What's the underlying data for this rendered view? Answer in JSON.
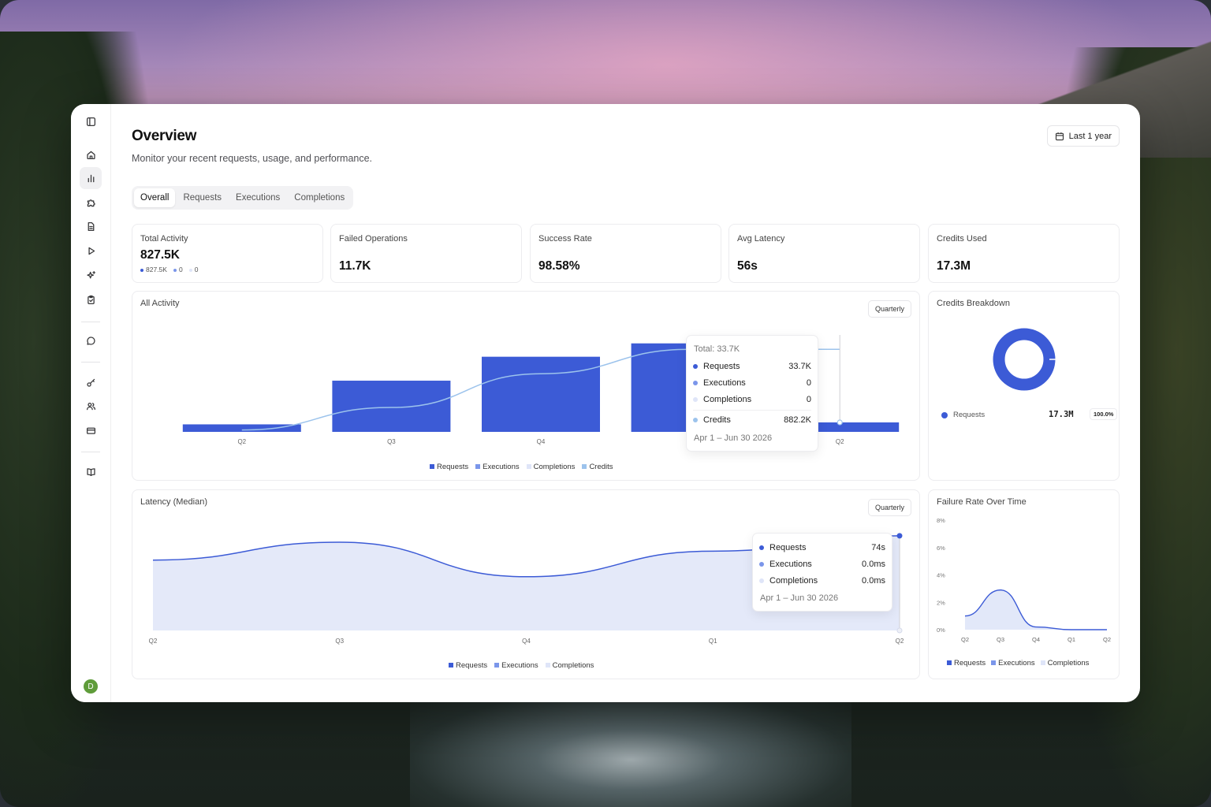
{
  "colors": {
    "requests": "#3c5bd6",
    "executions": "#7b96ea",
    "completions": "#dfe5f8",
    "credits": "#9cc3ec",
    "avatar": "#5f9c3a"
  },
  "sidebar": {
    "items": [
      {
        "name": "sidebar-toggle-icon"
      },
      {
        "name": "home-icon"
      },
      {
        "name": "bar-chart-icon",
        "active": true
      },
      {
        "name": "puzzle-icon"
      },
      {
        "name": "document-icon"
      },
      {
        "name": "play-icon"
      },
      {
        "name": "sparkles-icon"
      },
      {
        "name": "clipboard-check-icon"
      },
      {
        "name": "chat-icon"
      },
      {
        "name": "key-icon"
      },
      {
        "name": "users-icon"
      },
      {
        "name": "credit-card-icon"
      },
      {
        "name": "book-icon"
      }
    ],
    "avatar_initial": "D"
  },
  "header": {
    "title": "Overview",
    "subtitle": "Monitor your recent requests, usage, and performance.",
    "date_range": "Last 1 year"
  },
  "tabs": [
    "Overall",
    "Requests",
    "Executions",
    "Completions"
  ],
  "stats": {
    "total_activity": {
      "label": "Total Activity",
      "value": "827.5K",
      "legend": [
        "827.5K",
        "0",
        "0"
      ]
    },
    "failed_operations": {
      "label": "Failed Operations",
      "value": "11.7K"
    },
    "success_rate": {
      "label": "Success Rate",
      "value": "98.58%"
    },
    "avg_latency": {
      "label": "Avg Latency",
      "value": "56s"
    },
    "credits_used": {
      "label": "Credits Used",
      "value": "17.3M"
    }
  },
  "all_activity": {
    "title": "All Activity",
    "interval": "Quarterly",
    "legend": [
      "Requests",
      "Executions",
      "Completions",
      "Credits"
    ],
    "tooltip": {
      "total": "Total: 33.7K",
      "rows": [
        {
          "label": "Requests",
          "value": "33.7K"
        },
        {
          "label": "Executions",
          "value": "0"
        },
        {
          "label": "Completions",
          "value": "0"
        },
        {
          "label": "Credits",
          "value": "882.2K"
        }
      ],
      "date": "Apr 1 – Jun 30 2026"
    }
  },
  "credits_breakdown": {
    "title": "Credits Breakdown",
    "rows": [
      {
        "label": "Requests",
        "value": "17.3M",
        "pct": "100.0%"
      }
    ]
  },
  "latency": {
    "title": "Latency (Median)",
    "interval": "Quarterly",
    "legend": [
      "Requests",
      "Executions",
      "Completions"
    ],
    "tooltip": {
      "rows": [
        {
          "label": "Requests",
          "value": "74s"
        },
        {
          "label": "Executions",
          "value": "0.0ms"
        },
        {
          "label": "Completions",
          "value": "0.0ms"
        }
      ],
      "date": "Apr 1 – Jun 30 2026"
    }
  },
  "failure_rate": {
    "title": "Failure Rate Over Time",
    "legend": [
      "Requests",
      "Executions",
      "Completions"
    ]
  },
  "chart_data": [
    {
      "type": "bar",
      "title": "All Activity",
      "categories": [
        "Q2",
        "Q3",
        "Q4",
        "Q1",
        "Q2"
      ],
      "series": [
        {
          "name": "Requests",
          "values": [
            2.7,
            18.4,
            27.0,
            31.8,
            3.4
          ]
        },
        {
          "name": "Executions",
          "values": [
            0,
            0,
            0,
            0,
            0
          ]
        },
        {
          "name": "Completions",
          "values": [
            0,
            0,
            0,
            0,
            0
          ]
        }
      ],
      "line_series": {
        "name": "Credits",
        "values": [
          0.02,
          0.26,
          0.62,
          0.88,
          0.88
        ]
      },
      "ylim": [
        0,
        33.7
      ]
    },
    {
      "type": "pie",
      "title": "Credits Breakdown",
      "categories": [
        "Requests"
      ],
      "values": [
        100.0
      ]
    },
    {
      "type": "area",
      "title": "Latency (Median)",
      "categories": [
        "Q2",
        "Q3",
        "Q4",
        "Q1",
        "Q2"
      ],
      "series": [
        {
          "name": "Requests",
          "values": [
            55,
            69,
            42,
            62,
            74
          ]
        },
        {
          "name": "Executions",
          "values": [
            0,
            0,
            0,
            0,
            0
          ]
        },
        {
          "name": "Completions",
          "values": [
            0,
            0,
            0,
            0,
            0
          ]
        }
      ],
      "ylim": [
        0,
        85
      ]
    },
    {
      "type": "area",
      "title": "Failure Rate Over Time",
      "categories": [
        "Q2",
        "Q3",
        "Q4",
        "Q1",
        "Q2"
      ],
      "y_ticks": [
        "8%",
        "6%",
        "4%",
        "2%",
        "0%"
      ],
      "series": [
        {
          "name": "Requests",
          "values": [
            1.0,
            2.9,
            0.2,
            0.0,
            0.0
          ]
        }
      ],
      "ylim": [
        0,
        8
      ]
    }
  ]
}
